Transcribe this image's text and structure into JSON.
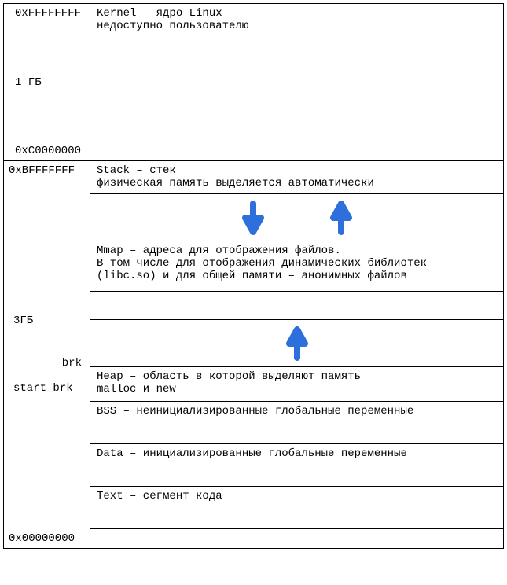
{
  "addresses": {
    "top": "0xFFFFFFFF",
    "kernel_size": "1 ГБ",
    "kernel_bottom": "0xC0000000",
    "user_top": "0xBFFFFFFF",
    "user_size": "3ГБ",
    "brk": "brk",
    "start_brk": "start_brk",
    "bottom": "0x00000000"
  },
  "segments": {
    "kernel_line1": "Kernel – ядро Linux",
    "kernel_line2": "недоступно пользователю",
    "stack_line1": "Stack – стек",
    "stack_line2": "физическая память выделяется автоматически",
    "mmap_line1": "Mmap – адреса для отображения файлов.",
    "mmap_line2": "В том числе для отображения динамических библиотек",
    "mmap_line3": "(libc.so) и для общей памяти – анонимных файлов",
    "heap_line1": "Heap – область в которой выделяют память",
    "heap_line2": "malloc и new",
    "bss": "BSS – неинициализированные глобальные переменные",
    "data": "Data – инициализированные глобальные переменные",
    "text": "Text – сегмент кода"
  },
  "arrow_color": "#2d6fdb"
}
